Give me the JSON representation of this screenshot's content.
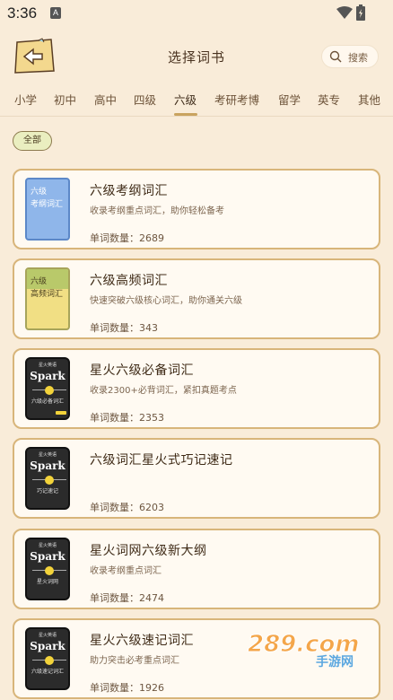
{
  "status": {
    "time": "3:36",
    "notif": "A"
  },
  "header": {
    "title": "选择词书",
    "search_label": "搜索"
  },
  "tabs": [
    "小学",
    "初中",
    "高中",
    "四级",
    "六级",
    "考研考博",
    "留学",
    "英专",
    "其他"
  ],
  "active_tab": "六级",
  "filter": {
    "all_label": "全部"
  },
  "books": [
    {
      "title": "六级考纲词汇",
      "desc": "收录考纲重点词汇，助你轻松备考",
      "count": "单词数量：2689",
      "cover_line1": "六级",
      "cover_line2": "考纲词汇"
    },
    {
      "title": "六级高频词汇",
      "desc": "快速突破六级核心词汇，助你通关六级",
      "count": "单词数量：343",
      "cover_line1": "六级",
      "cover_line2": "高频词汇"
    },
    {
      "title": "星火六级必备词汇",
      "desc": "收录2300+必背词汇，紧扣真题考点",
      "count": "单词数量：2353",
      "cover_brand": "Spark",
      "cover_top": "星火英语",
      "cover_sub": "六级必备词汇"
    },
    {
      "title": "六级词汇星火式巧记速记",
      "desc": "",
      "count": "单词数量：6203",
      "cover_brand": "Spark",
      "cover_top": "星火英语",
      "cover_sub": "巧记速记"
    },
    {
      "title": "星火词网六级新大纲",
      "desc": "收录考纲重点词汇",
      "count": "单词数量：2474",
      "cover_brand": "Spark",
      "cover_top": "星火英语",
      "cover_sub": "星火词网"
    },
    {
      "title": "星火六级速记词汇",
      "desc": "助力突击必考重点词汇",
      "count": "单词数量：1926",
      "cover_brand": "Spark",
      "cover_top": "星火英语",
      "cover_sub": "六级速记词汇"
    }
  ],
  "watermark": {
    "brand": "289.com",
    "sub": "手游网"
  },
  "colors": {
    "background": "#f9ecd9",
    "card_border": "#d8b57a",
    "accent": "#c9a35f"
  }
}
